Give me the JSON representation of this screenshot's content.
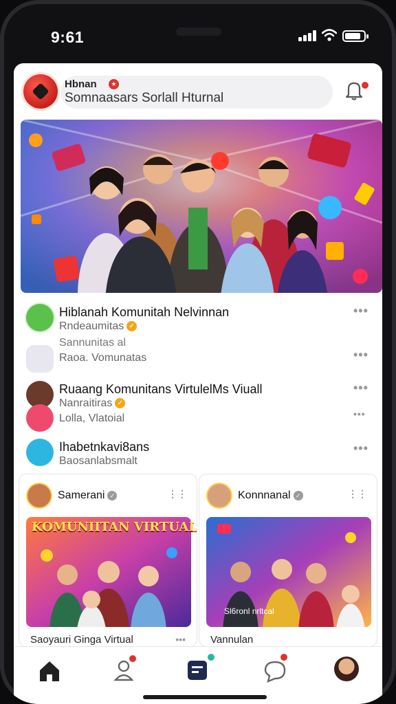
{
  "status_bar": {
    "time": "9:61"
  },
  "header": {
    "brand_name": "Hbnan",
    "search_text": "Somnaasars Sorlall Hturnal",
    "notification_icon": "bell-icon"
  },
  "communities": [
    {
      "title": "Hiblanah Komunitah Nelvinnan",
      "subtitle": "Rndeaumitas",
      "verified": true
    },
    {
      "title": "Sannunitas al",
      "subtitle": "Raoa. Vomunatas",
      "verified": false
    },
    {
      "title": "Ruaang Komunitans VirtulelMs Viuall",
      "subtitle": "Nanraitiras",
      "verified": true
    },
    {
      "title": "Lolla, Vlatoial",
      "subtitle": "",
      "verified": false
    },
    {
      "title": "Ihabetnkavi8ans",
      "subtitle": "Baosanlabsmalt",
      "verified": false
    }
  ],
  "cards": [
    {
      "author": "Samerani",
      "banner_text": "KOMUNIITAN VIRTUAL",
      "caption": "Saoyauri Ginga Virtual"
    },
    {
      "author": "Konnnanal",
      "badge_text": "Sl6ronl nrltcal",
      "caption": "Vannulan"
    }
  ],
  "bottom_nav": [
    {
      "icon": "home-icon",
      "active": true
    },
    {
      "icon": "people-icon",
      "badge": true
    },
    {
      "icon": "create-icon",
      "badge": true
    },
    {
      "icon": "chat-icon",
      "badge": true
    },
    {
      "icon": "profile-avatar-icon"
    }
  ],
  "colors": {
    "accent_red": "#e0332c",
    "verified_gold": "#f0a71b",
    "background": "#ffffff"
  }
}
